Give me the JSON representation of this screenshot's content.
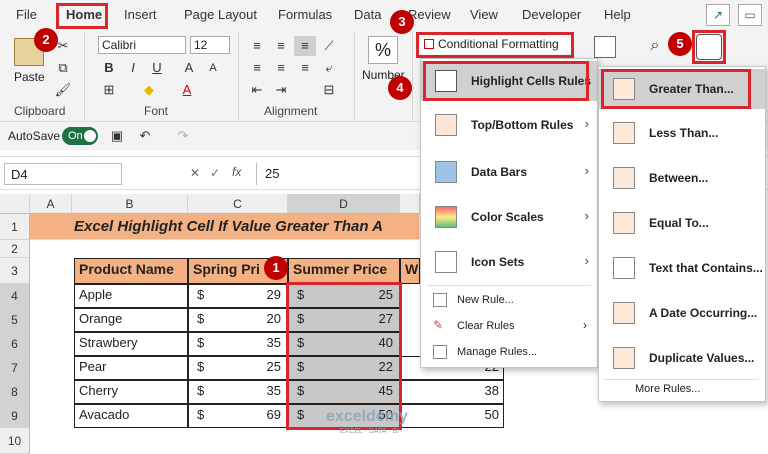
{
  "menubar": {
    "tabs": [
      "File",
      "Home",
      "Insert",
      "Page Layout",
      "Formulas",
      "Data",
      "Review",
      "View",
      "Developer",
      "Help"
    ]
  },
  "ribbon": {
    "clipboard": {
      "paste": "Paste",
      "label": "Clipboard"
    },
    "font": {
      "name": "Calibri",
      "size": "12",
      "label": "Font",
      "bold": "B",
      "italic": "I",
      "underline": "U"
    },
    "alignment": {
      "label": "Alignment"
    },
    "number": {
      "label": "Number",
      "symbol": "%"
    },
    "conditional_formatting": "Conditional Formatting"
  },
  "qab": {
    "autosave": "AutoSave",
    "toggle": "On"
  },
  "formula_bar": {
    "name_box": "D4",
    "fx": "fx",
    "value": "25"
  },
  "sheet": {
    "columns": [
      "A",
      "B",
      "C",
      "D"
    ],
    "rows": [
      "1",
      "2",
      "3",
      "4",
      "5",
      "6",
      "7",
      "8",
      "9",
      "10"
    ],
    "title": "Excel Highlight Cell If Value Greater Than A",
    "headers": {
      "b": "Product Name",
      "c": "Spring Pri",
      "d": "Summer Price",
      "e": "W"
    },
    "data": [
      {
        "product": "Apple",
        "spring": "29",
        "summer": "25",
        "e": ""
      },
      {
        "product": "Orange",
        "spring": "20",
        "summer": "27",
        "e": ""
      },
      {
        "product": "Strawbery",
        "spring": "35",
        "summer": "40",
        "e": ""
      },
      {
        "product": "Pear",
        "spring": "25",
        "summer": "22",
        "e": "22"
      },
      {
        "product": "Cherry",
        "spring": "35",
        "summer": "45",
        "e": "38"
      },
      {
        "product": "Avacado",
        "spring": "69",
        "summer": "50",
        "e": "50"
      }
    ],
    "currency": "$"
  },
  "cf_menu": [
    {
      "label": "Highlight Cells Rules",
      "arrow": "›"
    },
    {
      "label": "Top/Bottom Rules",
      "arrow": "›"
    },
    {
      "label": "Data Bars",
      "arrow": "›"
    },
    {
      "label": "Color Scales",
      "arrow": "›"
    },
    {
      "label": "Icon Sets",
      "arrow": "›"
    }
  ],
  "cf_menu_bottom": [
    {
      "label": "New Rule..."
    },
    {
      "label": "Clear Rules",
      "arrow": "›"
    },
    {
      "label": "Manage Rules..."
    }
  ],
  "submenu": [
    {
      "label": "Greater Than..."
    },
    {
      "label": "Less Than..."
    },
    {
      "label": "Between..."
    },
    {
      "label": "Equal To..."
    },
    {
      "label": "Text that Contains..."
    },
    {
      "label": "A Date Occurring..."
    },
    {
      "label": "Duplicate Values..."
    }
  ],
  "submenu_more": "More Rules...",
  "badges": [
    "1",
    "2",
    "3",
    "4",
    "5"
  ],
  "watermark": "exceldemy",
  "watermark_sub": "EXCEL · DATA · BI",
  "colors": {
    "header": "#f4b183",
    "selected": "#c8c8c8",
    "badge": "#c00000",
    "accent_green": "#1e7145"
  }
}
